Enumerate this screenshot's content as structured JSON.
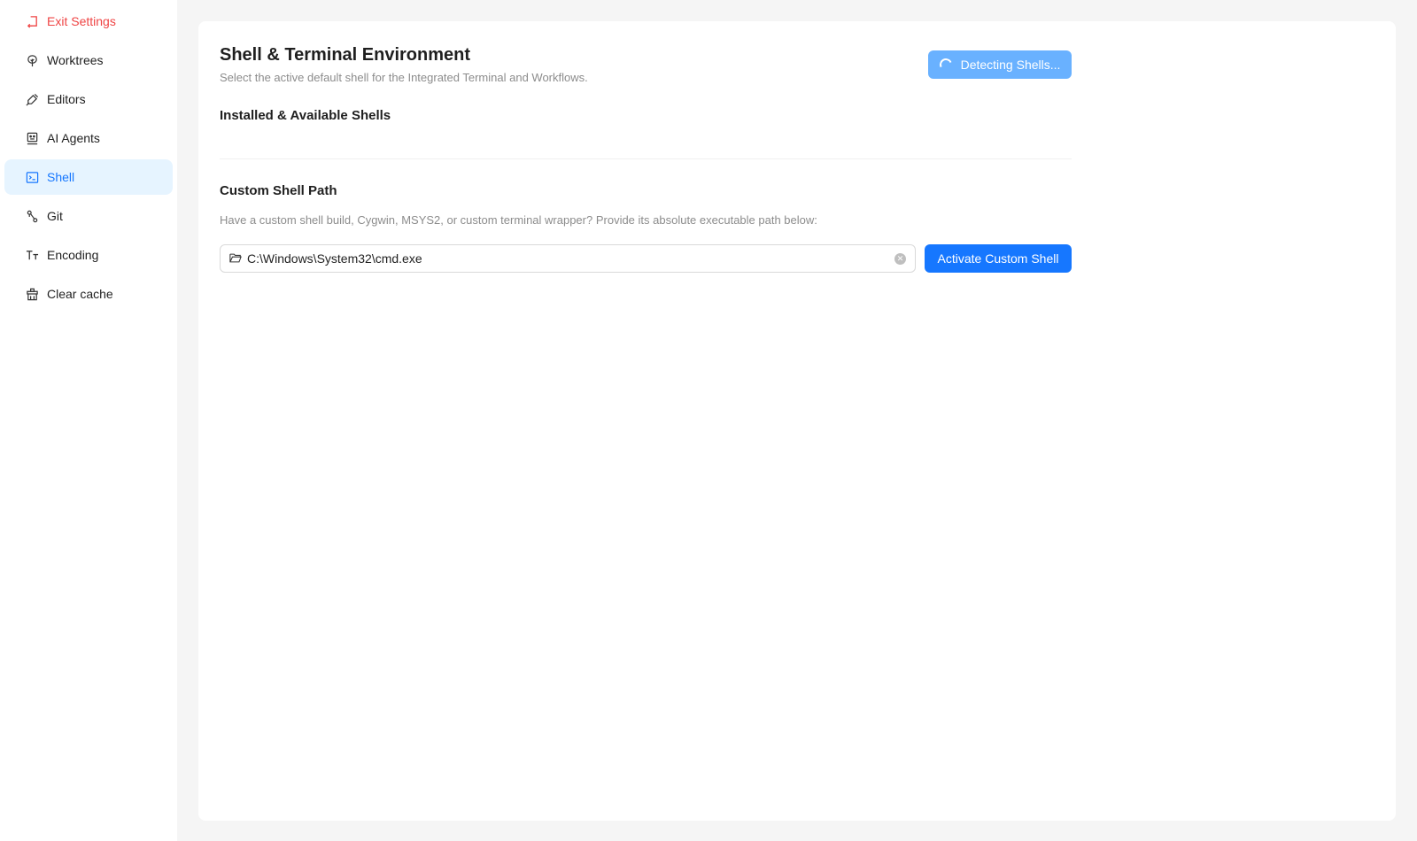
{
  "sidebar": {
    "items": [
      {
        "label": "Exit Settings",
        "icon": "exit-icon"
      },
      {
        "label": "Worktrees",
        "icon": "worktree-icon"
      },
      {
        "label": "Editors",
        "icon": "editor-icon"
      },
      {
        "label": "AI Agents",
        "icon": "ai-agent-icon"
      },
      {
        "label": "Shell",
        "icon": "terminal-icon",
        "active": true
      },
      {
        "label": "Git",
        "icon": "git-icon"
      },
      {
        "label": "Encoding",
        "icon": "font-size-icon"
      },
      {
        "label": "Clear cache",
        "icon": "cache-icon"
      }
    ]
  },
  "header": {
    "title": "Shell & Terminal Environment",
    "subtitle": "Select the active default shell for the Integrated Terminal and Workflows.",
    "detect_label": "Detecting Shells..."
  },
  "shells": {
    "title": "Installed & Available Shells"
  },
  "custom": {
    "title": "Custom Shell Path",
    "description": "Have a custom shell build, Cygwin, MSYS2, or custom terminal wrapper? Provide its absolute executable path below:",
    "path_value": "C:\\Windows\\System32\\cmd.exe",
    "activate_label": "Activate Custom Shell"
  },
  "colors": {
    "accent": "#1677ff",
    "accent_light": "#69b1ff",
    "active_bg": "#e6f4ff",
    "danger": "#ef4444"
  }
}
